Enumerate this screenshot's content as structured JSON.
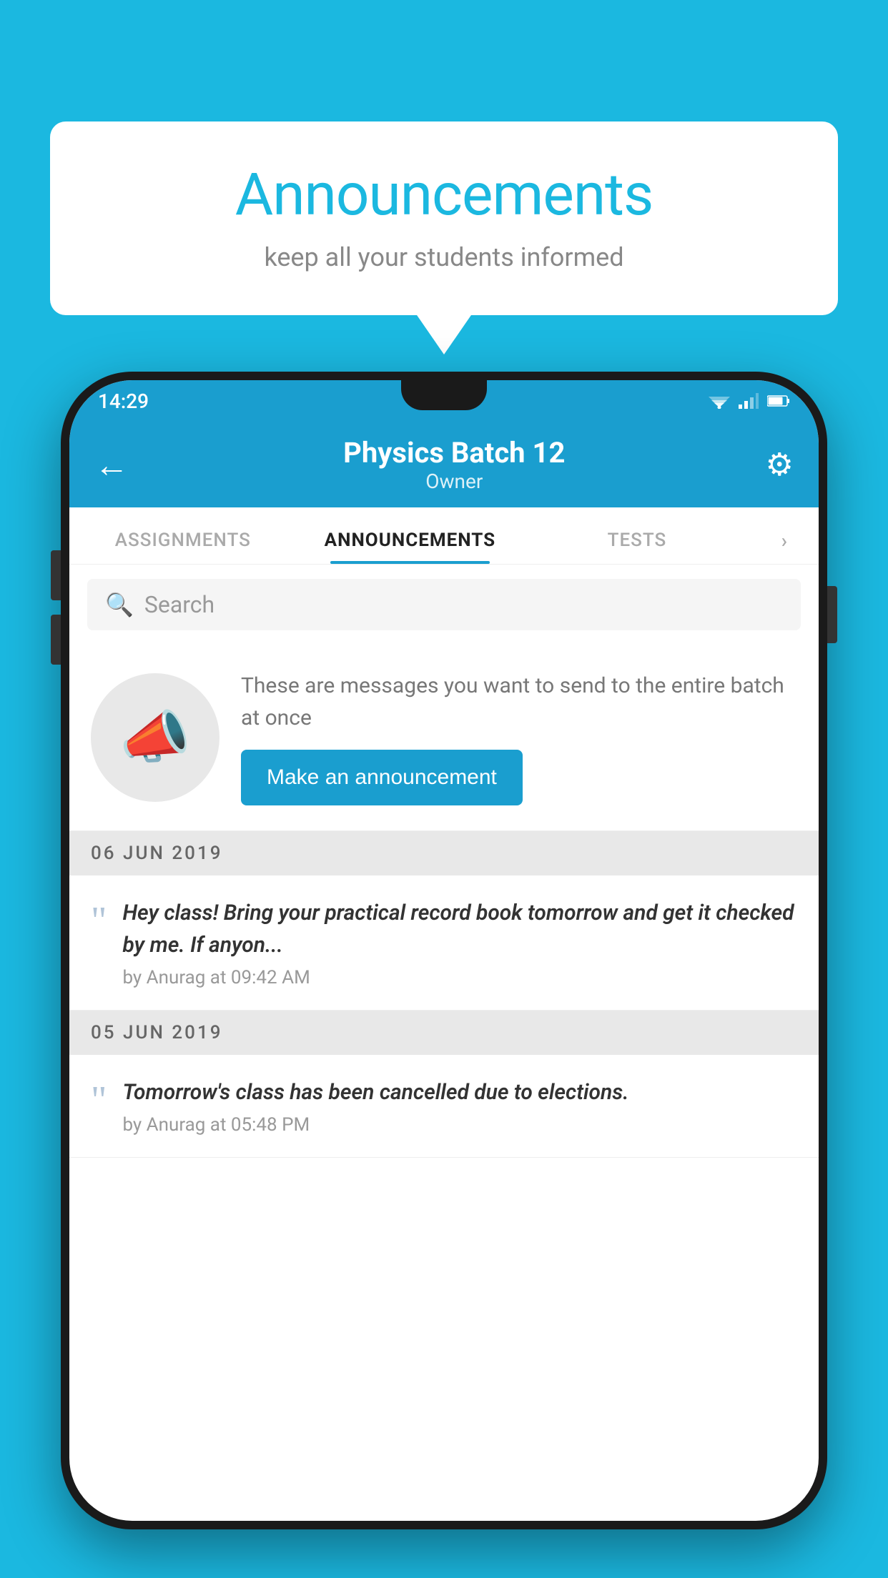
{
  "background_color": "#1bb8e0",
  "bubble": {
    "title": "Announcements",
    "subtitle": "keep all your students informed"
  },
  "phone": {
    "status_bar": {
      "time": "14:29"
    },
    "app_bar": {
      "title": "Physics Batch 12",
      "subtitle": "Owner",
      "back_label": "←",
      "gear_label": "⚙"
    },
    "tabs": [
      {
        "label": "ASSIGNMENTS",
        "active": false
      },
      {
        "label": "ANNOUNCEMENTS",
        "active": true
      },
      {
        "label": "TESTS",
        "active": false
      }
    ],
    "search": {
      "placeholder": "Search"
    },
    "prompt": {
      "text": "These are messages you want to send to the entire batch at once",
      "button_label": "Make an announcement"
    },
    "announcements": [
      {
        "date": "06  JUN  2019",
        "text": "Hey class! Bring your practical record book tomorrow and get it checked by me. If anyon...",
        "meta": "by Anurag at 09:42 AM"
      },
      {
        "date": "05  JUN  2019",
        "text": "Tomorrow's class has been cancelled due to elections.",
        "meta": "by Anurag at 05:48 PM"
      }
    ]
  }
}
